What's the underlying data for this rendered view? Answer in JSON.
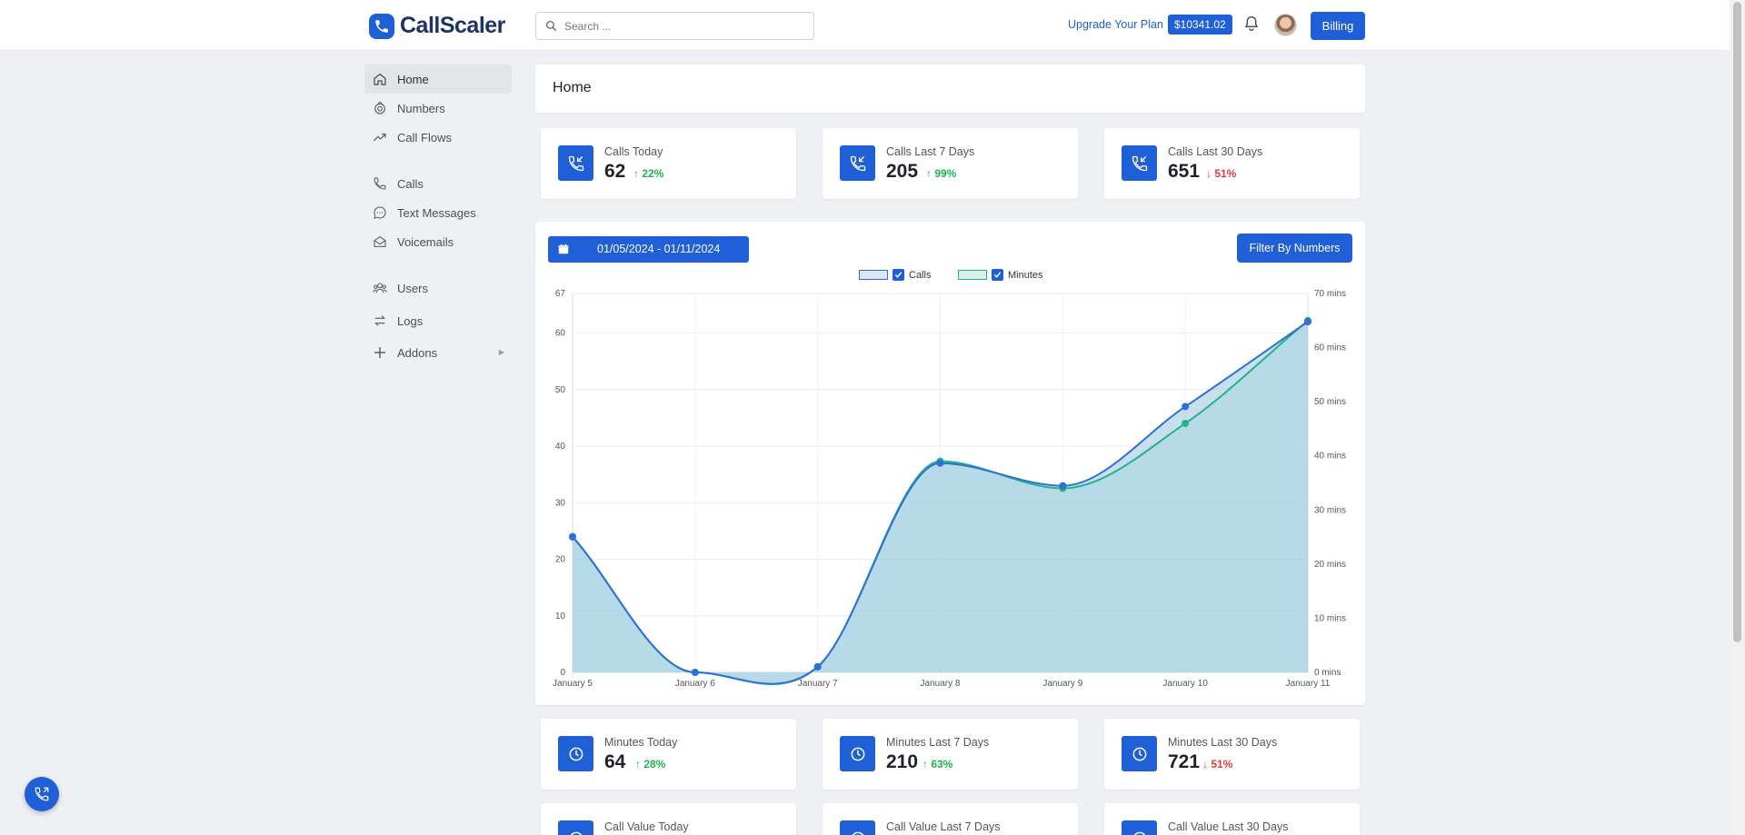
{
  "header": {
    "brand": "CallScaler",
    "search_placeholder": "Search ...",
    "upgrade_label": "Upgrade Your Plan",
    "balance": "$10341.02",
    "billing_label": "Billing"
  },
  "sidebar": {
    "items": [
      {
        "label": "Home",
        "icon": "home-icon"
      },
      {
        "label": "Numbers",
        "icon": "numbers-icon"
      },
      {
        "label": "Call Flows",
        "icon": "trend-icon"
      },
      {
        "label": "Calls",
        "icon": "phone-icon"
      },
      {
        "label": "Text Messages",
        "icon": "chat-icon"
      },
      {
        "label": "Voicemails",
        "icon": "mail-icon"
      },
      {
        "label": "Users",
        "icon": "users-icon"
      },
      {
        "label": "Logs",
        "icon": "swap-icon"
      },
      {
        "label": "Addons",
        "icon": "plus-icon"
      }
    ]
  },
  "page": {
    "title": "Home"
  },
  "call_stats": [
    {
      "label": "Calls Today",
      "value": "62",
      "change": "↑ 22%",
      "direction": "up"
    },
    {
      "label": "Calls Last 7 Days",
      "value": "205",
      "change": "↑ 99%",
      "direction": "up"
    },
    {
      "label": "Calls Last 30 Days",
      "value": "651",
      "change": "↓ 51%",
      "direction": "down"
    }
  ],
  "minute_stats": [
    {
      "label": "Minutes Today",
      "value": "64",
      "change": "↑ 28%",
      "direction": "up"
    },
    {
      "label": "Minutes Last 7 Days",
      "value": "210",
      "change": "↑ 63%",
      "direction": "up"
    },
    {
      "label": "Minutes Last 30 Days",
      "value": "721",
      "change": "↓ 51%",
      "direction": "down"
    }
  ],
  "value_stats": [
    {
      "label": "Call Value Today"
    },
    {
      "label": "Call Value Last 7 Days"
    },
    {
      "label": "Call Value Last 30 Days"
    }
  ],
  "chart_controls": {
    "date_range": "01/05/2024 - 01/11/2024",
    "filter_label": "Filter By Numbers"
  },
  "colors": {
    "accent": "#1f5fd8",
    "calls": "#2f6fd6",
    "minutes": "#21b38a",
    "fill": "#c7e0ee"
  },
  "chart_data": {
    "type": "line",
    "categories": [
      "January 5",
      "January 6",
      "January 7",
      "January 8",
      "January 9",
      "January 10",
      "January 11"
    ],
    "series": [
      {
        "name": "Calls",
        "axis": "left",
        "values": [
          24,
          0,
          1,
          37,
          33,
          47,
          62
        ]
      },
      {
        "name": "Minutes",
        "axis": "right",
        "values": [
          25,
          0,
          1,
          39,
          34,
          46,
          65
        ]
      }
    ],
    "y_left": {
      "min": 0,
      "max": 67,
      "ticks": [
        "0",
        "10",
        "20",
        "30",
        "40",
        "50",
        "60",
        "67"
      ]
    },
    "y_right": {
      "min": 0,
      "max": 70,
      "ticks": [
        "0 mins",
        "10 mins",
        "20 mins",
        "30 mins",
        "40 mins",
        "50 mins",
        "60 mins",
        "70 mins"
      ]
    },
    "legend_position": "top-center",
    "grid": true
  }
}
